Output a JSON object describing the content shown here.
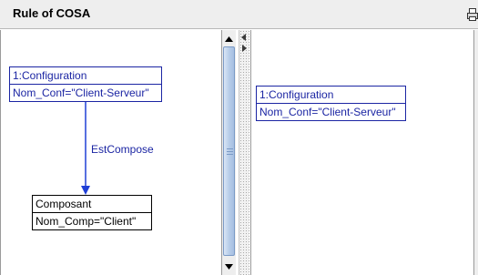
{
  "window": {
    "title": "Rule of COSA"
  },
  "left_diagram": {
    "source_node": {
      "header": "1:Configuration",
      "attribute": "Nom_Conf=\"Client-Serveur\""
    },
    "relation_label": "EstCompose",
    "target_node": {
      "header": "Composant",
      "attribute": "Nom_Comp=\"Client\""
    }
  },
  "right_diagram": {
    "node": {
      "header": "1:Configuration",
      "attribute": "Nom_Conf=\"Client-Serveur\""
    }
  },
  "colors": {
    "node_blue": "#1b25a3",
    "arrow_blue": "#1f3fd6",
    "scroll_thumb": "#b7cde9"
  },
  "icons": [
    "print-icon",
    "scroll-up-arrow-icon",
    "scroll-down-arrow-icon",
    "divider-left-arrow-icon",
    "divider-right-arrow-icon"
  ]
}
